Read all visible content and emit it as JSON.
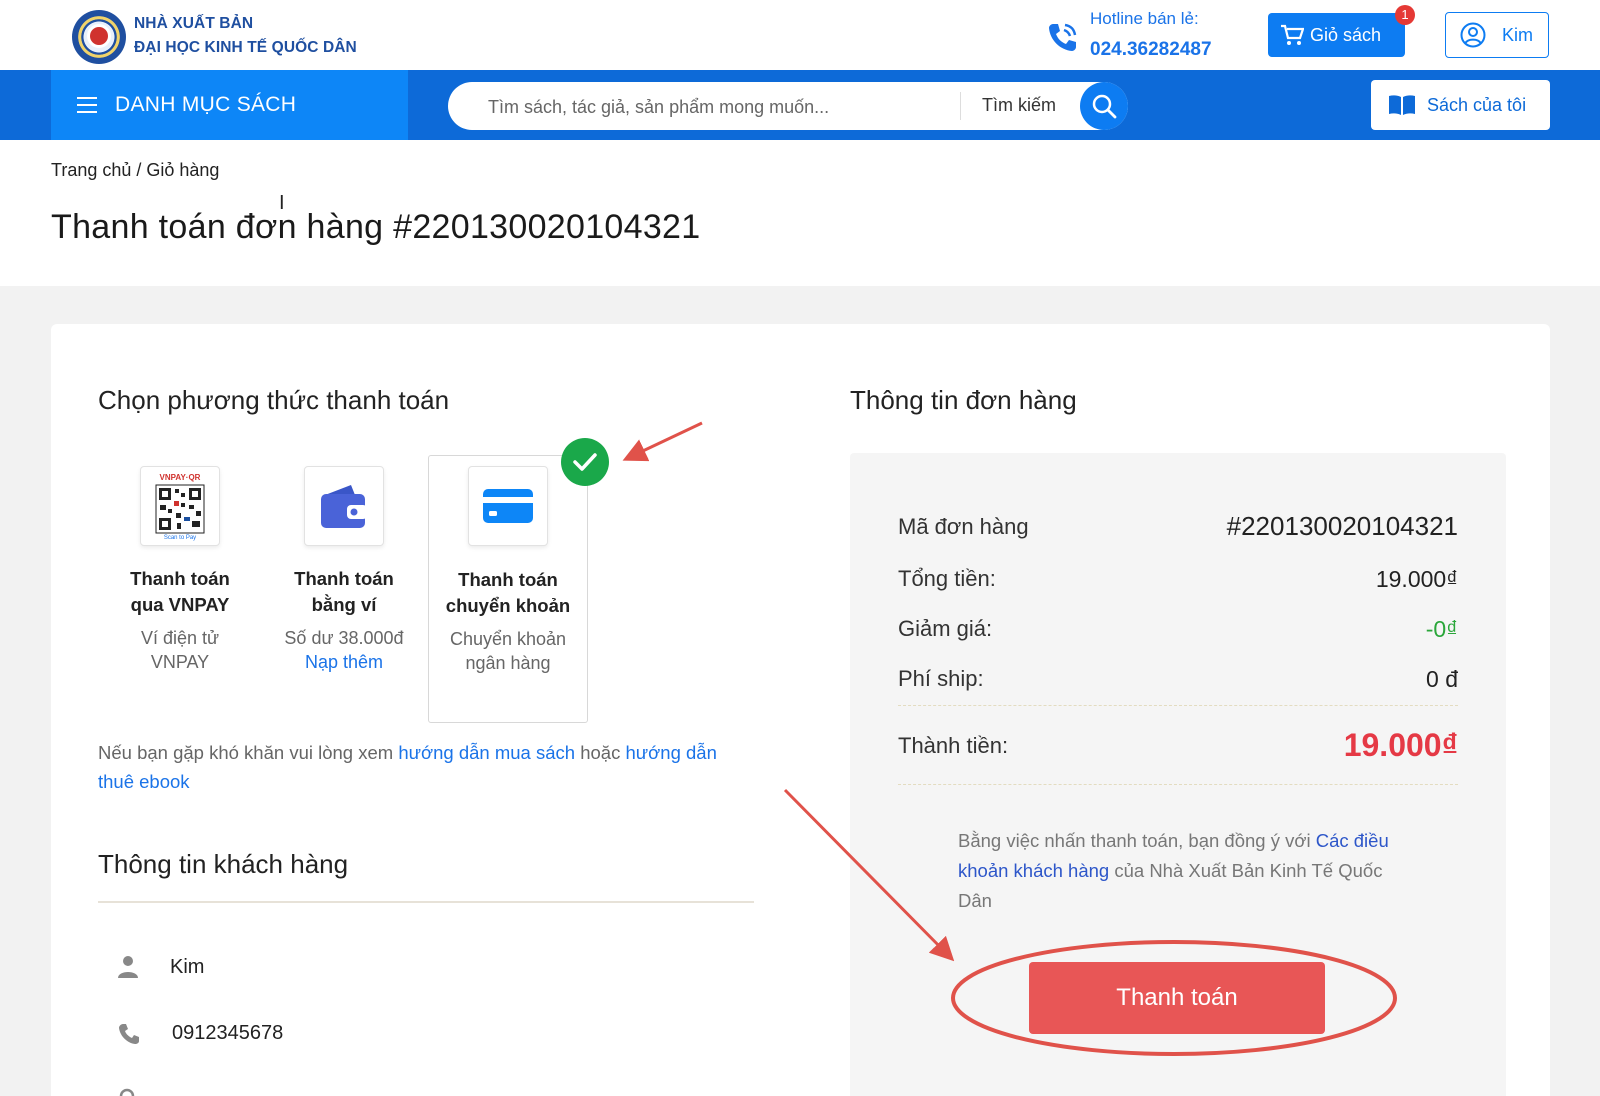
{
  "header": {
    "brand_line1": "NHÀ XUẤT BẢN",
    "brand_line2": "ĐẠI HỌC KINH TẾ QUỐC DÂN",
    "hotline_label": "Hotline bán lẻ:",
    "hotline_number": "024.36282487",
    "cart_label": "Giỏ sách",
    "cart_count": "1",
    "user_name": "Kim"
  },
  "nav": {
    "catalog_label": "DANH MỤC SÁCH",
    "search_placeholder": "Tìm sách, tác giả, sản phẩm mong muốn...",
    "search_label": "Tìm kiếm",
    "my_books_label": "Sách của tôi"
  },
  "page": {
    "breadcrumb": "Trang chủ / Giỏ hàng",
    "title": "Thanh toán đơn hàng #220130020104321"
  },
  "payment": {
    "section_title": "Chọn phương thức thanh toán",
    "options": [
      {
        "name_line1": "Thanh toán",
        "name_line2": "qua VNPAY",
        "sub_line1": "Ví điện tử",
        "sub_line2": "VNPAY",
        "icon": "vnpay-qr-icon"
      },
      {
        "name_line1": "Thanh toán",
        "name_line2": "bằng ví",
        "sub_line1": "Số dư 38.000đ",
        "link": "Nạp thêm",
        "icon": "wallet-icon"
      },
      {
        "name_line1": "Thanh toán",
        "name_line2": "chuyển khoản",
        "sub_line1": "Chuyển khoản",
        "sub_line2": "ngân hàng",
        "icon": "credit-card-icon",
        "selected": true
      }
    ],
    "help_prefix": "Nếu bạn gặp khó khăn vui lòng xem",
    "help_link1": "hướng dẫn mua sách",
    "help_mid": "hoặc",
    "help_link2": "hướng dẫn thuê ebook"
  },
  "customer": {
    "section_title": "Thông tin khách hàng",
    "name": "Kim",
    "phone": "0912345678"
  },
  "order": {
    "section_title": "Thông tin đơn hàng",
    "code_label": "Mã đơn hàng",
    "code_value": "#220130020104321",
    "total_label": "Tổng tiền:",
    "total_value": "19.000₫",
    "discount_label": "Giảm giá:",
    "discount_value": "-0₫",
    "ship_label": "Phí ship:",
    "ship_value": "0 đ",
    "final_label": "Thành tiền:",
    "final_value": "19.000₫",
    "terms_prefix": "Bằng việc nhấn thanh toán, bạn đồng ý với",
    "terms_link": "Các điều khoản khách hàng",
    "terms_suffix": "của Nhà Xuất Bản Kinh Tế Quốc Dân",
    "pay_button": "Thanh toán"
  },
  "colors": {
    "primary": "#0d6ad8",
    "accent_red": "#e85656",
    "price_red": "#e53945",
    "discount_green": "#2aa63a",
    "annotation_red": "#e0524a"
  }
}
